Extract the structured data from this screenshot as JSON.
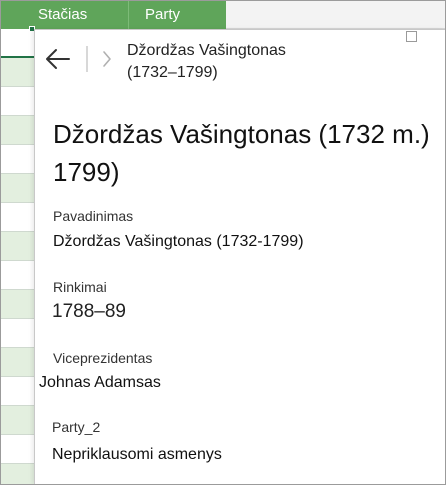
{
  "header": {
    "columns": [
      "Stačias",
      "Party"
    ]
  },
  "card": {
    "breadcrumb": {
      "line1": "Džordžas Vašingtonas",
      "line2": "(1732–1799)"
    },
    "title": "Džordžas Vašingtonas (1732 m.) 1799)",
    "fields": [
      {
        "label": "Pavadinimas",
        "value": "Džordžas Vašingtonas (1732-1799)"
      },
      {
        "label": "Rinkimai",
        "value": "1788–89"
      },
      {
        "label": "Viceprezidentas",
        "value": "Johnas Adamsas"
      },
      {
        "label": "Party_2",
        "value": "Nepriklausomi asmenys"
      }
    ]
  },
  "icons": {
    "back": "back-arrow-icon",
    "forward": "chevron-right-icon",
    "maximize": "maximize-icon"
  },
  "colors": {
    "header_green": "#5fa55a",
    "row_band": "#e3efdf",
    "selection": "#217346"
  }
}
